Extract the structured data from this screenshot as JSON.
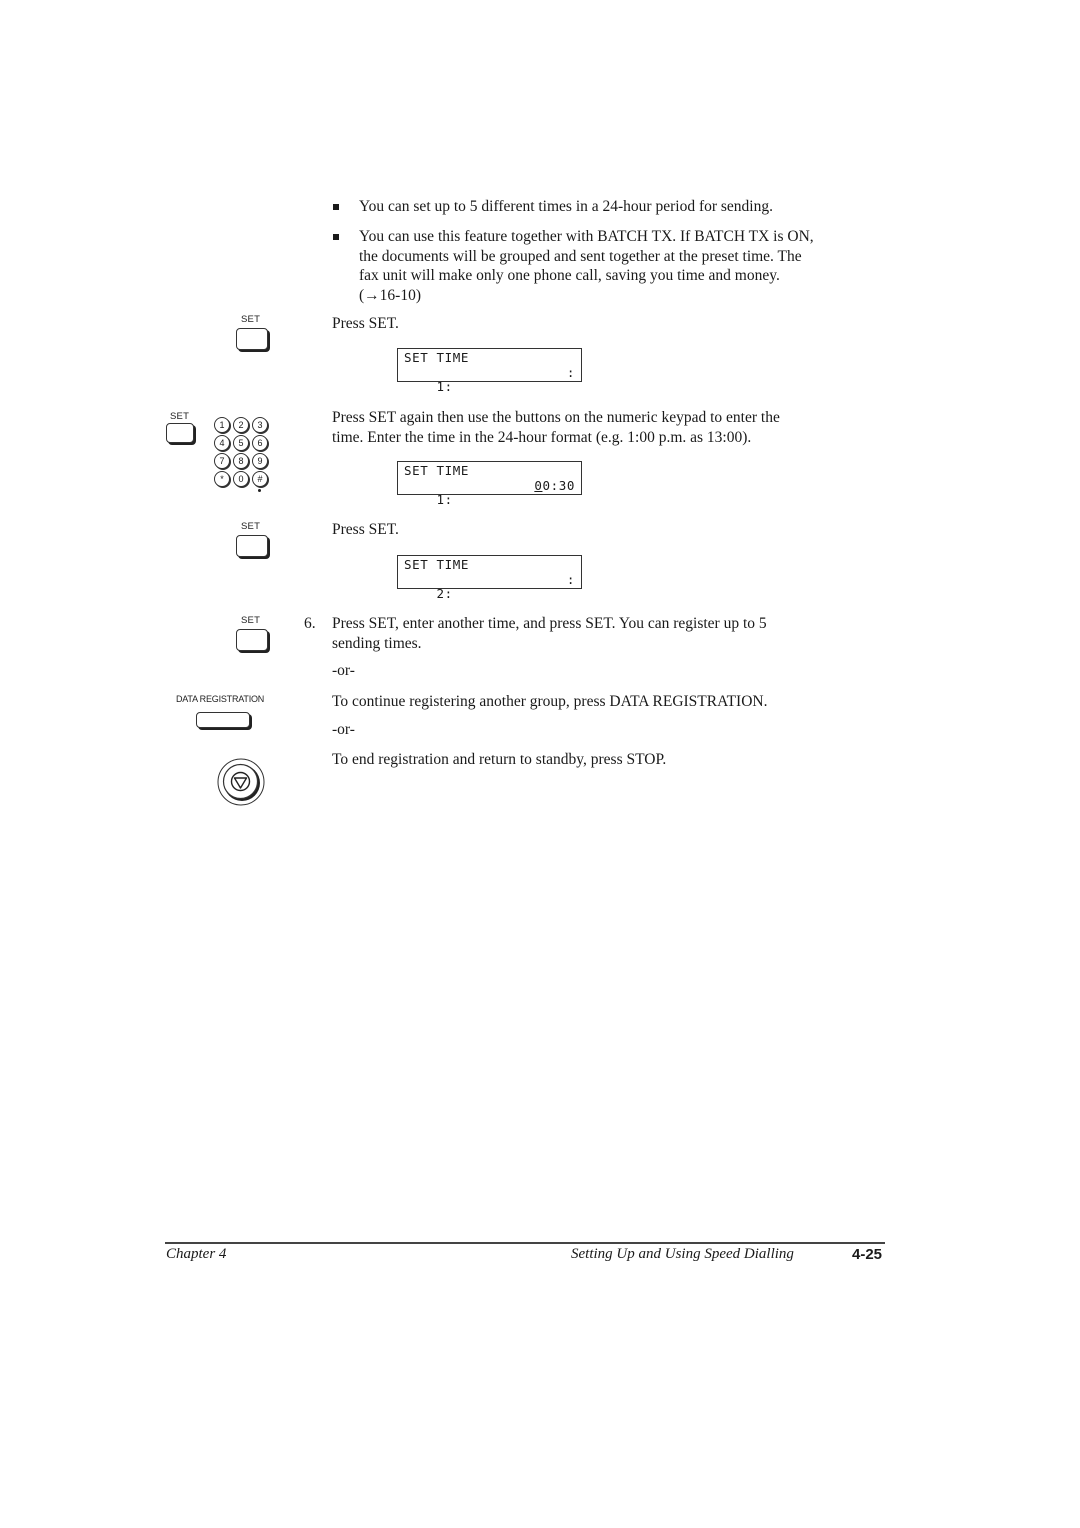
{
  "bullets": [
    {
      "lines": [
        "You can set up to 5 different times in a 24-hour period for sending."
      ]
    },
    {
      "lines": [
        "You can use this feature together with BATCH TX. If BATCH TX is ON,",
        "the documents will be grouped and sent together at the preset time. The",
        "fax unit will make only one phone call, saving you time and money.",
        "(→16-10)"
      ]
    }
  ],
  "steps": {
    "press_set_1": "Press SET.",
    "lcd1": {
      "line1": "SET TIME",
      "line2_left": "1:",
      "line2_right": ":"
    },
    "press_set_again": [
      "Press SET again then use the buttons on the numeric keypad to enter the",
      "time. Enter the time in the 24-hour format (e.g. 1:00 p.m. as 13:00)."
    ],
    "lcd2": {
      "line1": "SET TIME",
      "line2_left": "1:",
      "line2_right_cursor": "0",
      "line2_right": "0:30"
    },
    "press_set_2": "Press SET.",
    "lcd3": {
      "line1": "SET TIME",
      "line2_left": "2:",
      "line2_right": ":"
    },
    "step6_number": "6.",
    "step6": [
      "Press SET, enter another time, and press SET. You can register up to 5",
      "sending times."
    ],
    "or1": "-or-",
    "continue": "To continue registering another group, press DATA REGISTRATION.",
    "or2": "-or-",
    "end": "To end registration and return to standby, press STOP."
  },
  "icons": {
    "set_label": "SET",
    "data_registration_label": "DATA REGISTRATION",
    "keypad": [
      "1",
      "2",
      "3",
      "4",
      "5",
      "6",
      "7",
      "8",
      "9",
      "*",
      "0",
      "#"
    ]
  },
  "footer": {
    "chapter": "Chapter 4",
    "section": "Setting Up and Using Speed Dialling",
    "page": "4-25"
  }
}
